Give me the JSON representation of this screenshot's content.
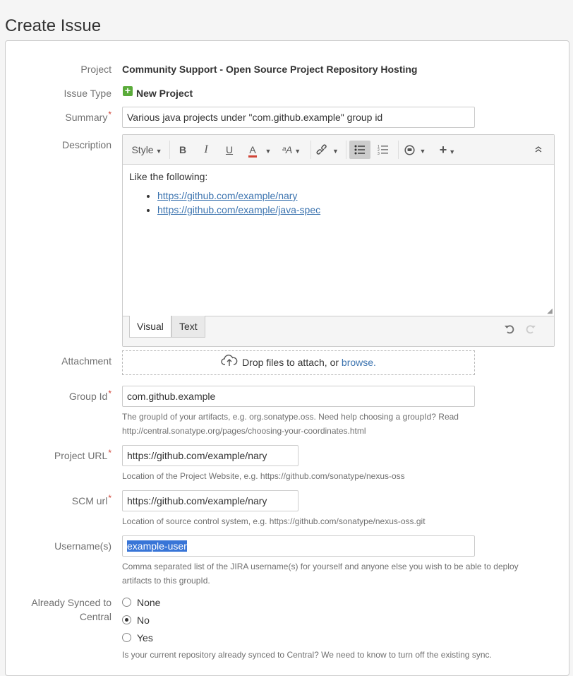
{
  "page": {
    "title": "Create Issue"
  },
  "fields": {
    "project": {
      "label": "Project",
      "value": "Community Support - Open Source Project Repository Hosting"
    },
    "issue_type": {
      "label": "Issue Type",
      "value": "New Project",
      "icon": "plus-icon"
    },
    "summary": {
      "label": "Summary",
      "required_mark": "*",
      "value": "Various java projects under \"com.github.example\" group id"
    },
    "description": {
      "label": "Description",
      "toolbar": {
        "style_label": "Style",
        "bold": "B",
        "italic": "I",
        "underline": "U",
        "text_color": "A",
        "font_size": "ᵃA"
      },
      "body": {
        "intro": "Like the following:",
        "links": [
          "https://github.com/example/nary",
          "https://github.com/example/java-spec"
        ]
      },
      "tabs": [
        "Visual",
        "Text"
      ]
    },
    "attachment": {
      "label": "Attachment",
      "drop_text": "Drop files to attach, or ",
      "browse_link": "browse."
    },
    "group_id": {
      "label": "Group Id",
      "required_mark": "*",
      "value": "com.github.example",
      "help_line1": "The groupId of your artifacts, e.g. org.sonatype.oss. Need help choosing a groupId? Read",
      "help_line2": "http://central.sonatype.org/pages/choosing-your-coordinates.html"
    },
    "project_url": {
      "label": "Project URL",
      "required_mark": "*",
      "value": "https://github.com/example/nary",
      "help": "Location of the Project Website, e.g. https://github.com/sonatype/nexus-oss"
    },
    "scm_url": {
      "label": "SCM url",
      "required_mark": "*",
      "value": "https://github.com/example/nary",
      "help": "Location of source control system, e.g. https://github.com/sonatype/nexus-oss.git"
    },
    "usernames": {
      "label": "Username(s)",
      "value": "example-user",
      "help_line1": "Comma separated list of the JIRA username(s) for yourself and anyone else you wish to be able to deploy",
      "help_line2": "artifacts to this groupId."
    },
    "synced": {
      "label_line1": "Already Synced to",
      "label_line2": "Central",
      "options": [
        "None",
        "No",
        "Yes"
      ],
      "selected": "No",
      "help": "Is your current repository already synced to Central? We need to know to turn off the existing sync."
    }
  },
  "colors": {
    "required": "#d04437",
    "link": "#3b73af",
    "issue_type_icon": "#5aab3a",
    "selection": "#3875d7"
  }
}
